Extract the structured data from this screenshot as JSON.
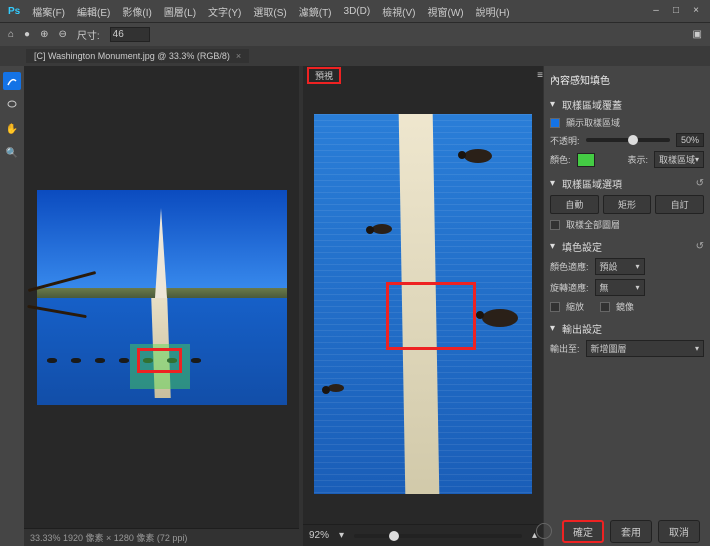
{
  "menu": {
    "items": [
      "檔案(F)",
      "編輯(E)",
      "影像(I)",
      "圖層(L)",
      "文字(Y)",
      "選取(S)",
      "濾鏡(T)",
      "3D(D)",
      "檢視(V)",
      "視窗(W)",
      "說明(H)"
    ]
  },
  "toolbar": {
    "size_label": "尺寸:",
    "size_value": "46"
  },
  "tab": {
    "title": "[C] Washington Monument.jpg @ 33.3% (RGB/8)"
  },
  "left_status": "33.33%   1920 像素 × 1280 像素 (72 ppi)",
  "preview": {
    "label": "預視",
    "zoom": "92%",
    "knob_pct": 21
  },
  "panel": {
    "title": "內容感知填色",
    "s1": {
      "hdr": "取樣區域覆蓋",
      "show_label": "顯示取樣區域",
      "opacity_label": "不透明:",
      "opacity_val": "50%",
      "opacity_knob": 50,
      "color_label": "顏色:",
      "indicates_label": "表示:",
      "indicates_val": "取樣區域"
    },
    "s2": {
      "hdr": "取樣區域選項",
      "auto": "自動",
      "rect": "矩形",
      "custom": "自訂",
      "all_label": "取樣全部圖層"
    },
    "s3": {
      "hdr": "填色設定",
      "color_adapt_label": "顏色適應:",
      "color_adapt_val": "預設",
      "rotation_label": "旋轉適應:",
      "rotation_val": "無",
      "scale_label": "縮放",
      "mirror_label": "鏡像"
    },
    "s4": {
      "hdr": "輸出設定",
      "out_label": "輸出至:",
      "out_val": "新增圖層"
    }
  },
  "footer": {
    "ok": "確定",
    "apply": "套用",
    "cancel": "取消"
  }
}
